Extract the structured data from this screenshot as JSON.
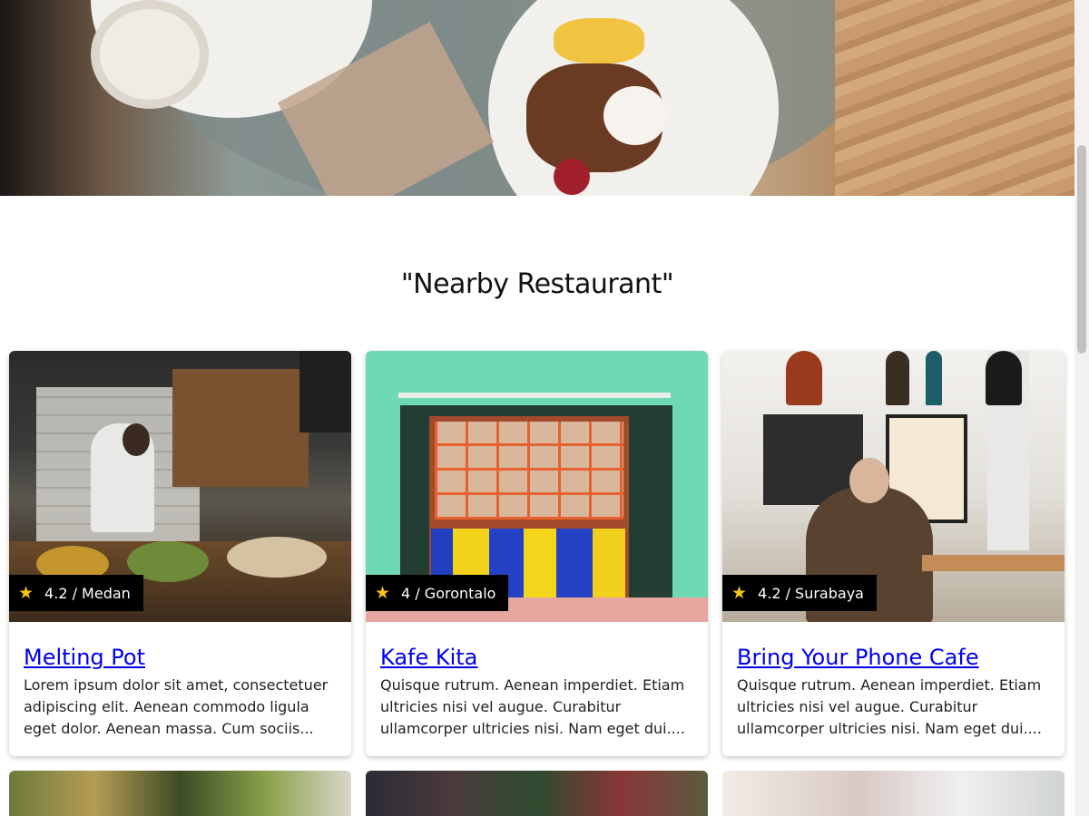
{
  "section": {
    "title": "\"Nearby Restaurant\""
  },
  "cards": [
    {
      "rating": "4.2",
      "city": "Medan",
      "badge": "4.2 / Medan",
      "name": "Melting Pot",
      "description": "Lorem ipsum dolor sit amet, consectetuer adipiscing elit. Aenean commodo ligula eget dolor. Aenean massa. Cum sociis..."
    },
    {
      "rating": "4",
      "city": "Gorontalo",
      "badge": "4 / Gorontalo",
      "name": "Kafe Kita",
      "description": "Quisque rutrum. Aenean imperdiet. Etiam ultricies nisi vel augue. Curabitur ullamcorper ultricies nisi. Nam eget dui...."
    },
    {
      "rating": "4.2",
      "city": "Surabaya",
      "badge": "4.2 / Surabaya",
      "name": "Bring Your Phone Cafe",
      "description": "Quisque rutrum. Aenean imperdiet. Etiam ultricies nisi vel augue. Curabitur ullamcorper ultricies nisi. Nam eget dui...."
    }
  ],
  "icons": {
    "rating": "star-icon"
  },
  "colors": {
    "link": "#0000ee",
    "star": "#f5c518",
    "badge_bg": "#000000"
  }
}
